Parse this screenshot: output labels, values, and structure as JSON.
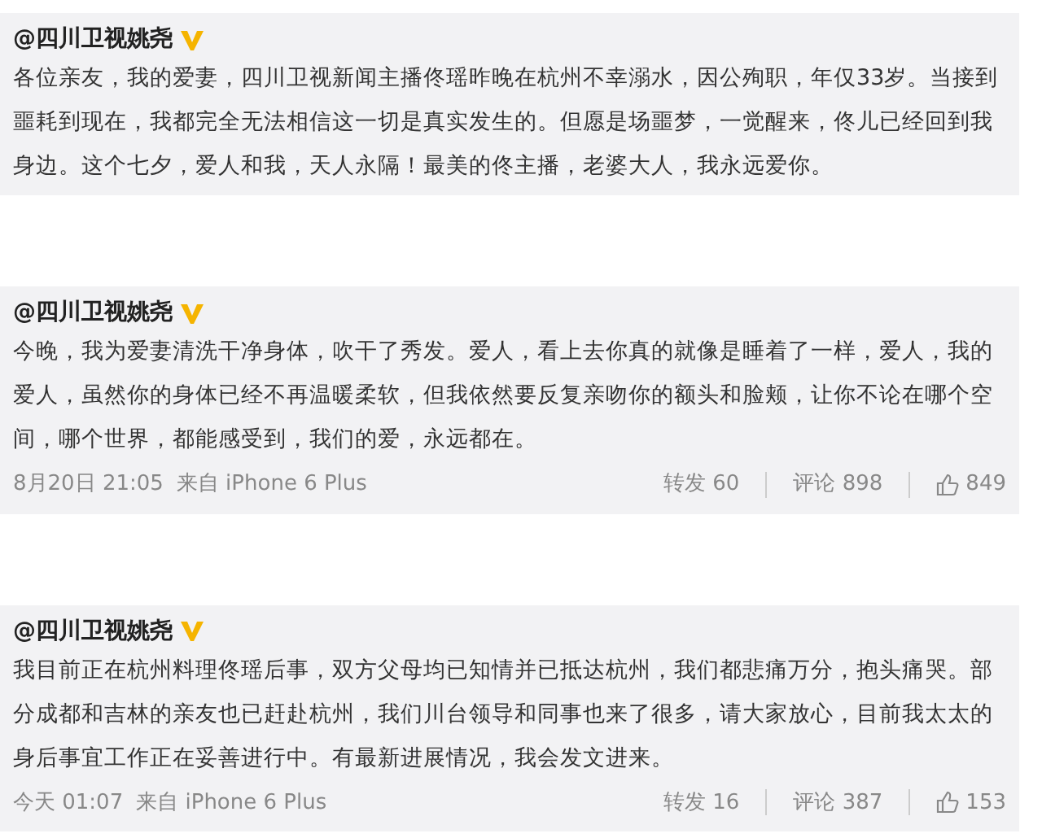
{
  "posts": [
    {
      "author": "@四川卫视姚尧",
      "verified": true,
      "text": "各位亲友，我的爱妻，四川卫视新闻主播佟瑶昨晚在杭州不幸溺水，因公殉职，年仅33岁。当接到噩耗到现在，我都完全无法相信这一切是真实发生的。但愿是场噩梦，一觉醒来，佟儿已经回到我身边。这个七夕，爱人和我，天人永隔！最美的佟主播，老婆大人，我永远爱你。"
    },
    {
      "author": "@四川卫视姚尧",
      "verified": true,
      "text": "今晚，我为爱妻清洗干净身体，吹干了秀发。爱人，看上去你真的就像是睡着了一样，爱人，我的爱人，虽然你的身体已经不再温暖柔软，但我依然要反复亲吻你的额头和脸颊，让你不论在哪个空间，哪个世界，都能感受到，我们的爱，永远都在。",
      "time": "8月20日 21:05",
      "source": "来自 iPhone 6 Plus",
      "reposts": "转发 60",
      "comments": "评论 898",
      "likes": "849"
    },
    {
      "author": "@四川卫视姚尧",
      "verified": true,
      "text": "我目前正在杭州料理佟瑶后事，双方父母均已知情并已抵达杭州，我们都悲痛万分，抱头痛哭。部分成都和吉林的亲友也已赶赴杭州，我们川台领导和同事也来了很多，请大家放心，目前我太太的身后事宜工作正在妥善进行中。有最新进展情况，我会发文进来。",
      "time": "今天 01:07",
      "source": "来自 iPhone 6 Plus",
      "reposts": "转发 16",
      "comments": "评论 387",
      "likes": "153"
    }
  ]
}
